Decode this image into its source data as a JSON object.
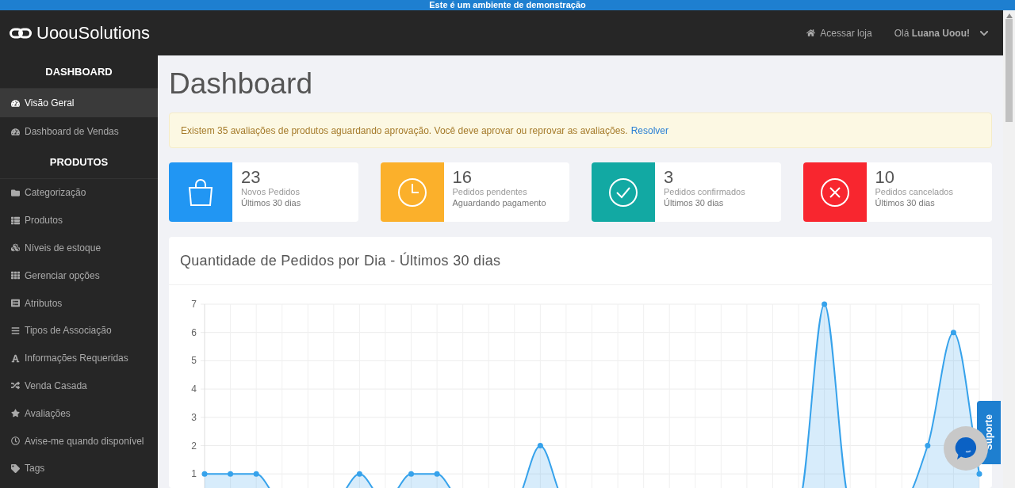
{
  "banner": "Este é um ambiente de demonstração",
  "header": {
    "logo": "**Uoou**Solutions",
    "store_link": "Acessar loja",
    "user_menu": "Olá **Luana Uoou!**"
  },
  "sidebar": {
    "sections": [
      {
        "heading": "DASHBOARD",
        "items": [
          {
            "label": "Visão Geral",
            "selected": true
          },
          {
            "label": "Dashboard de Vendas",
            "selected": false
          }
        ]
      },
      {
        "heading": "PRODUTOS",
        "items": [
          {
            "label": "Categorização",
            "selected": false
          },
          {
            "label": "Produtos",
            "selected": false
          },
          {
            "label": "Níveis de estoque",
            "selected": false
          },
          {
            "label": "Gerenciar opções",
            "selected": false
          },
          {
            "label": "Atributos",
            "selected": false
          },
          {
            "label": "Tipos de Associação",
            "selected": false
          },
          {
            "label": "Informações Requeridas",
            "selected": false
          },
          {
            "label": "Venda Casada",
            "selected": false
          },
          {
            "label": "Avaliações",
            "selected": false
          },
          {
            "label": "Avise-me quando disponível",
            "selected": false
          },
          {
            "label": "Tags",
            "selected": false
          }
        ]
      }
    ]
  },
  "page_title": "Dashboard",
  "alert": {
    "text": "Existem 35 avaliações de produtos aguardando aprovação. Você deve aprovar ou reprovar as avaliações.",
    "link": "Resolver"
  },
  "stats": [
    {
      "kind": "bag",
      "color": "#2196f3",
      "value": "23",
      "label": "Novos Pedidos",
      "sublabel": "Últimos 30 dias"
    },
    {
      "kind": "clock",
      "color": "#fbb02b",
      "value": "16",
      "label": "Pedidos pendentes",
      "sublabel": "Aguardando pagamento"
    },
    {
      "kind": "check",
      "color": "#12a9a3",
      "value": "3",
      "label": "Pedidos confirmados",
      "sublabel": "Últimos 30 dias"
    },
    {
      "kind": "cancel",
      "color": "#f8262f",
      "value": "10",
      "label": "Pedidos cancelados",
      "sublabel": "Últimos 30 dias"
    }
  ],
  "chart_card": {
    "title": "Quantidade de Pedidos por Dia - Últimos 30 dias",
    "chart_data": {
      "type": "area",
      "grid": true,
      "ylim": [
        0,
        7
      ],
      "yticks": [
        1,
        2,
        3,
        4,
        5,
        6,
        7
      ],
      "series": [
        {
          "color": "#36a2eb",
          "values": [
            1,
            1,
            1,
            0,
            0,
            0,
            1,
            0,
            1,
            1,
            0,
            0,
            0,
            2,
            0,
            0,
            0,
            0,
            0,
            0,
            0,
            0,
            0,
            0,
            7,
            0,
            0,
            0,
            2,
            6,
            1
          ]
        }
      ]
    }
  },
  "support_tab": "Suporte"
}
